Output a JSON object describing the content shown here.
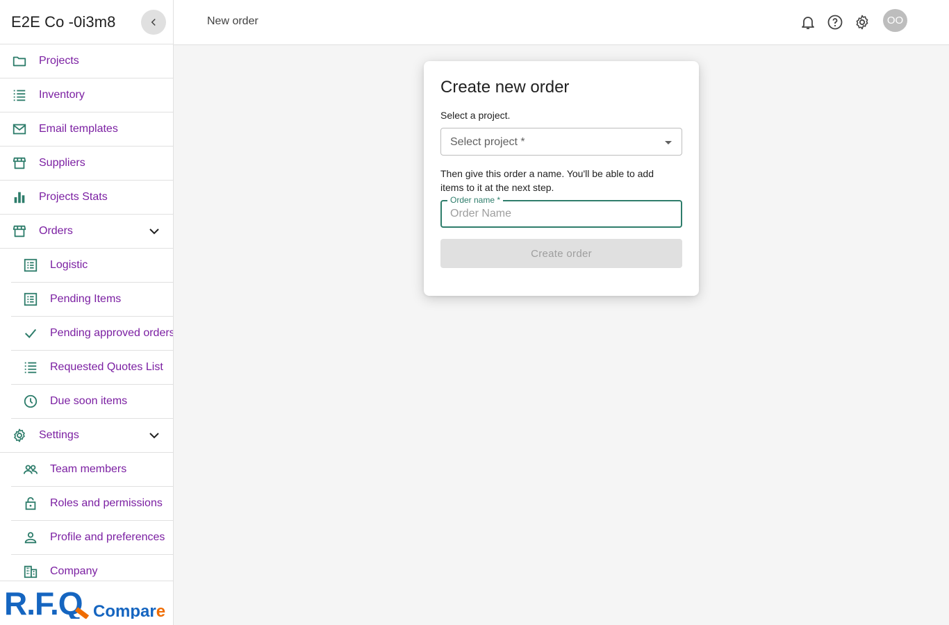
{
  "sidebar": {
    "company": "E2E Co -0i3m8",
    "items": [
      {
        "label": "Projects",
        "icon": "folder-icon"
      },
      {
        "label": "Inventory",
        "icon": "list-icon"
      },
      {
        "label": "Email templates",
        "icon": "mail-icon"
      },
      {
        "label": "Suppliers",
        "icon": "store-icon"
      },
      {
        "label": "Projects Stats",
        "icon": "bar-chart-icon"
      },
      {
        "label": "Orders",
        "icon": "store-icon",
        "expanded": true
      },
      {
        "label": "Logistic",
        "icon": "receipt-icon"
      },
      {
        "label": "Pending Items",
        "icon": "receipt-icon"
      },
      {
        "label": "Pending approved orders",
        "icon": "check-icon"
      },
      {
        "label": "Requested Quotes List",
        "icon": "list-icon"
      },
      {
        "label": "Due soon items",
        "icon": "clock-icon"
      },
      {
        "label": "Settings",
        "icon": "gear-icon",
        "expanded": true
      },
      {
        "label": "Team members",
        "icon": "people-icon"
      },
      {
        "label": "Roles and permissions",
        "icon": "lock-icon"
      },
      {
        "label": "Profile and preferences",
        "icon": "person-icon"
      },
      {
        "label": "Company",
        "icon": "building-icon"
      }
    ],
    "logo": {
      "main": "R.F.Q",
      "sub": "Compare"
    }
  },
  "topbar": {
    "breadcrumb": "New order",
    "avatar_initials": "OO"
  },
  "card": {
    "title": "Create new order",
    "project_help": "Select a project.",
    "project_placeholder": "Select project *",
    "name_help": "Then give this order a name. You'll be able to add items to it at the next step.",
    "name_label": "Order name *",
    "name_placeholder": "Order Name",
    "name_value": "",
    "submit_label": "Create order",
    "submit_disabled": true
  },
  "colors": {
    "accent": "#2e7d6b",
    "link": "#7b1fa2",
    "logo_blue": "#1565c0",
    "logo_orange": "#ef6c00"
  }
}
